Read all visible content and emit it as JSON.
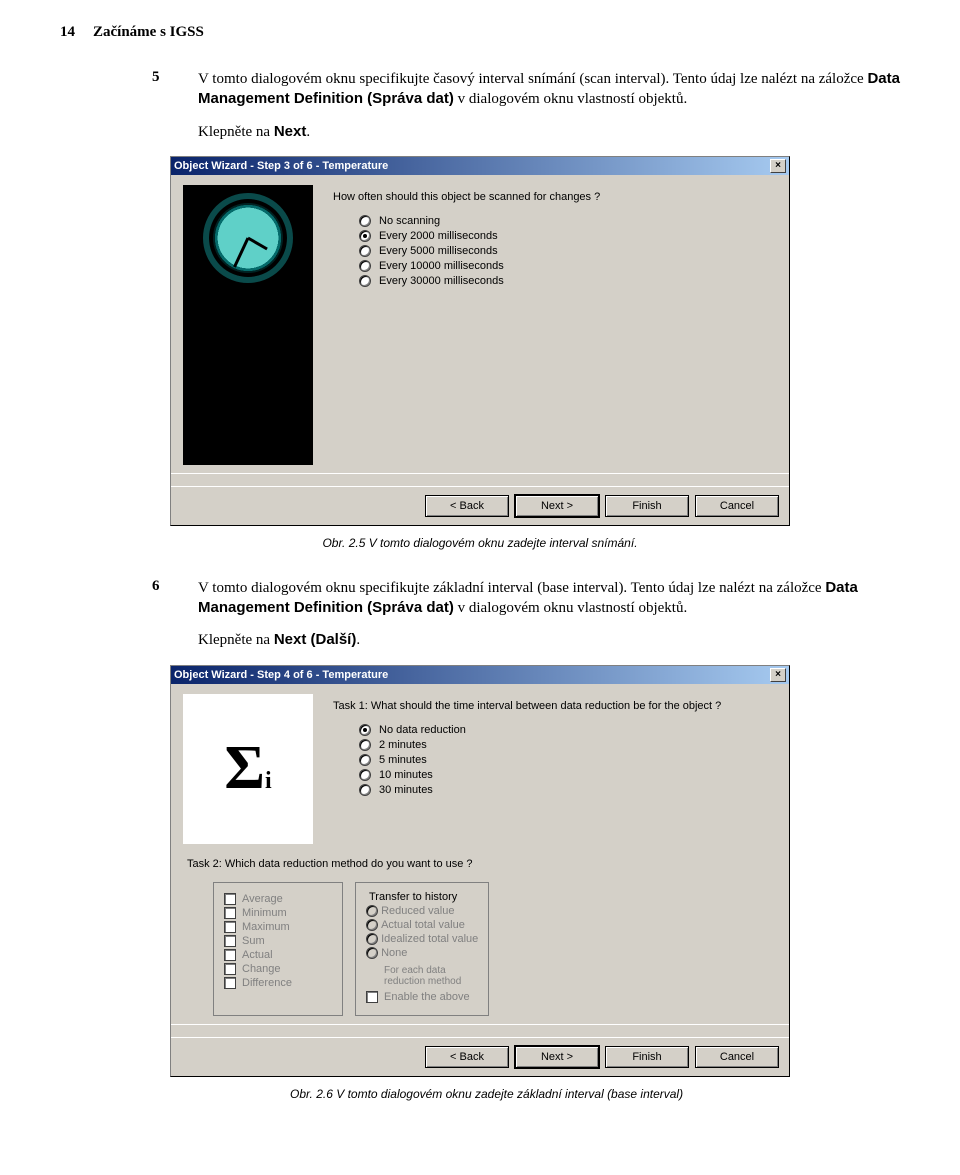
{
  "header": {
    "page_no": "14",
    "title": "Začínáme s IGSS"
  },
  "para5": {
    "num": "5",
    "t1": "V tomto dialogovém oknu specifikujte časový interval snímání (scan interval). Tento údaj lze nalézt na záložce ",
    "bold1": "Data Management Definition (Správa dat)",
    "t2": " v dialogovém oknu vlastností objektů.",
    "click_pre": "Klepněte na ",
    "click_bold": "Next",
    "click_post": "."
  },
  "dlg1": {
    "title": "Object Wizard - Step 3 of 6 - Temperature",
    "question": "How often should this object be scanned for changes ?",
    "opts": [
      {
        "label": "No scanning",
        "sel": false
      },
      {
        "label": "Every 2000 milliseconds",
        "sel": true
      },
      {
        "label": "Every 5000 milliseconds",
        "sel": false
      },
      {
        "label": "Every 10000 milliseconds",
        "sel": false
      },
      {
        "label": "Every 30000 milliseconds",
        "sel": false
      }
    ],
    "buttons": {
      "back": "< Back",
      "next": "Next >",
      "finish": "Finish",
      "cancel": "Cancel"
    }
  },
  "caption1": "Obr. 2.5  V tomto dialogovém oknu zadejte interval snímání.",
  "para6": {
    "num": "6",
    "t1": "V tomto dialogovém oknu specifikujte základní interval (base interval). Tento údaj lze nalézt na záložce ",
    "bold1": "Data Management Definition (Správa dat)",
    "t2": " v dialogovém oknu vlastností objektů.",
    "click_pre": "Klepněte na ",
    "click_bold": "Next (Další)",
    "click_post": "."
  },
  "dlg2": {
    "title": "Object Wizard - Step 4 of 6 - Temperature",
    "task1": "Task 1: What should the time interval between data reduction be for the object ?",
    "opts1": [
      {
        "label": "No data reduction",
        "sel": true
      },
      {
        "label": "2 minutes",
        "sel": false
      },
      {
        "label": "5 minutes",
        "sel": false
      },
      {
        "label": "10 minutes",
        "sel": false
      },
      {
        "label": "30 minutes",
        "sel": false
      }
    ],
    "task2": "Task 2: Which data reduction method do you want to use ?",
    "checks": [
      "Average",
      "Minimum",
      "Maximum",
      "Sum",
      "Actual",
      "Change",
      "Difference"
    ],
    "transfer_legend": "Transfer to history",
    "radios2": [
      "Reduced value",
      "Actual total value",
      "Idealized total value",
      "None"
    ],
    "note1": "For each data",
    "note2": "reduction method",
    "enable": "Enable the above",
    "buttons": {
      "back": "< Back",
      "next": "Next >",
      "finish": "Finish",
      "cancel": "Cancel"
    }
  },
  "caption2": "Obr. 2.6  V tomto dialogovém oknu zadejte základní interval (base interval)"
}
